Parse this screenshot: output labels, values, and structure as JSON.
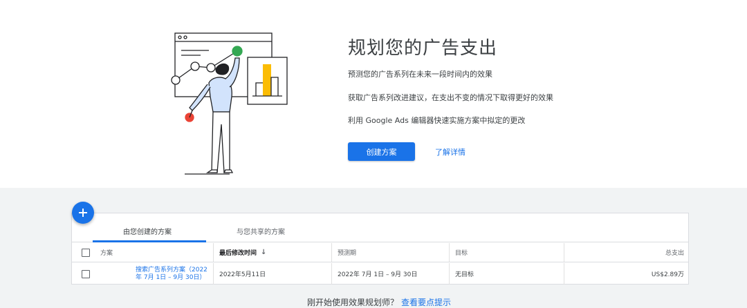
{
  "hero": {
    "title": "规划您的广告支出",
    "line1": "预测您的广告系列在未来一段时间内的效果",
    "line2": "获取广告系列改进建议，在支出不变的情况下取得更好的效果",
    "line3": "利用 Google Ads 编辑器快速实施方案中拟定的更改",
    "create_button": "创建方案",
    "learn_link": "了解详情"
  },
  "fab": {
    "label": "+"
  },
  "tabs": [
    {
      "label": "由您创建的方案",
      "active": true
    },
    {
      "label": "与您共享的方案",
      "active": false
    }
  ],
  "table": {
    "columns": [
      "方案",
      "最后修改时间",
      "预测期",
      "目标",
      "总支出"
    ],
    "sort_icon": "↓",
    "rows": [
      [
        "搜索广告系列方案（2022年 7月 1日 – 9月 30日）",
        "2022年5月11日",
        "2022年 7月 1日 – 9月 30日",
        "无目标",
        "US$2.89万"
      ]
    ]
  },
  "footer": {
    "text": "刚开始使用效果规划师？",
    "link": "查看要点提示"
  },
  "colors": {
    "accent": "#1a73e8",
    "chart_bar": "#fbbc04",
    "green_dot": "#34a853",
    "red_dot": "#ea4335"
  }
}
